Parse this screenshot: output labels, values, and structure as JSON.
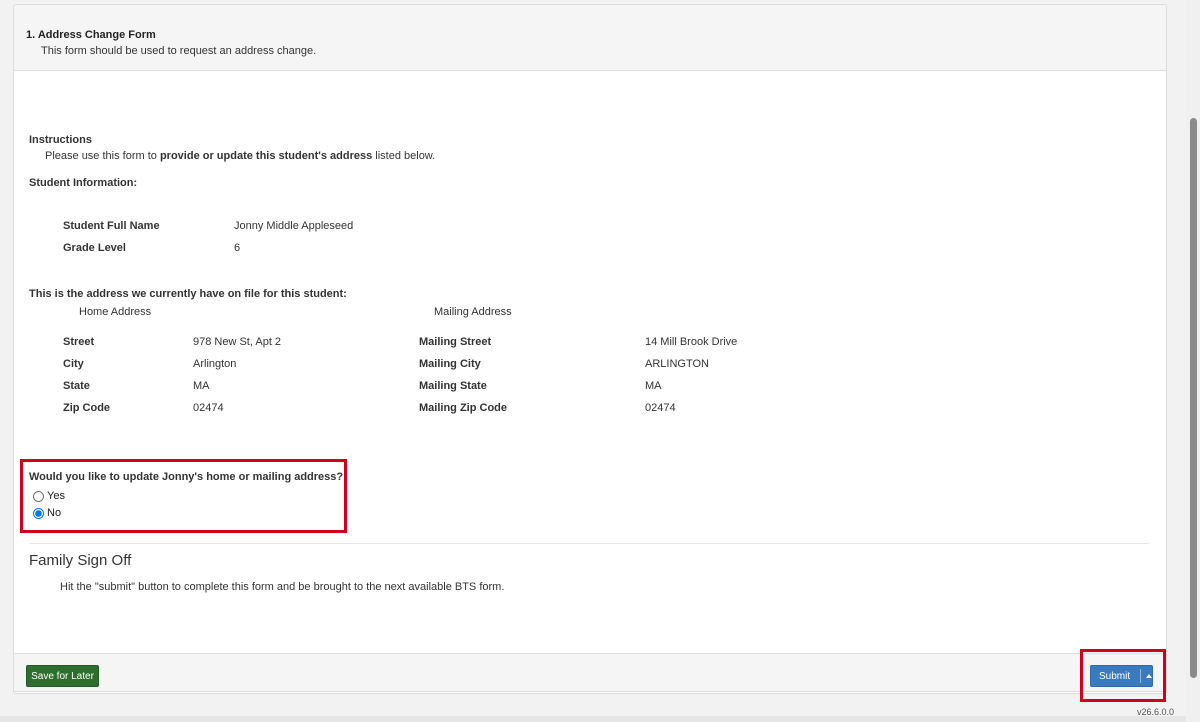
{
  "form": {
    "title": "1. Address Change Form",
    "description": "This form should be used to request an address change."
  },
  "instructions": {
    "heading": "Instructions",
    "text_prefix": "Please use this form to ",
    "text_bold": "provide or update this student's address",
    "text_suffix": " listed below."
  },
  "student_info": {
    "heading": "Student Information:",
    "rows": [
      {
        "label": "Student Full Name",
        "value": "Jonny Middle Appleseed"
      },
      {
        "label": "Grade Level",
        "value": "6"
      }
    ]
  },
  "address": {
    "heading": "This is the address we currently have on file for this student:",
    "home_header": "Home Address",
    "mailing_header": "Mailing Address",
    "home": [
      {
        "label": "Street",
        "value": "978 New St, Apt 2"
      },
      {
        "label": "City",
        "value": "Arlington"
      },
      {
        "label": "State",
        "value": "MA"
      },
      {
        "label": "Zip Code",
        "value": "02474"
      }
    ],
    "mailing": [
      {
        "label": "Mailing Street",
        "value": "14 Mill Brook Drive"
      },
      {
        "label": "Mailing City",
        "value": "ARLINGTON"
      },
      {
        "label": "Mailing State",
        "value": "MA"
      },
      {
        "label": "Mailing Zip Code",
        "value": "02474"
      }
    ]
  },
  "question": {
    "text": "Would you like to update Jonny's home or mailing address?",
    "options": [
      {
        "label": "Yes",
        "checked": false
      },
      {
        "label": "No",
        "checked": true
      }
    ]
  },
  "signoff": {
    "title": "Family Sign Off",
    "text": "Hit the \"submit\" button to complete this form and be brought to the next available BTS form."
  },
  "footer": {
    "save_label": "Save for Later",
    "submit_label": "Submit",
    "version": "v26.6.0.0"
  },
  "colors": {
    "save_button": "#2d6e2d",
    "submit_button": "#3a7bbf",
    "highlight_border": "#d0021b"
  }
}
